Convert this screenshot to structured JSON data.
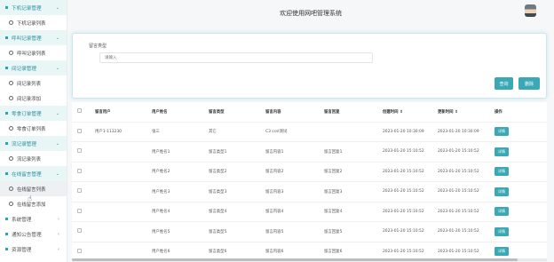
{
  "header": {
    "title": "欢迎使用网吧管理系统"
  },
  "sidebar": {
    "entries": [
      {
        "type": "group",
        "label": "下机记录管理",
        "chev": "⌄"
      },
      {
        "type": "item",
        "label": "下机记录列表"
      },
      {
        "type": "group",
        "label": "呼叫记录管理",
        "chev": "⌄"
      },
      {
        "type": "item",
        "label": "呼叫记录列表"
      },
      {
        "type": "group",
        "label": "间记录管理",
        "chev": "⌄"
      },
      {
        "type": "item",
        "label": "间记录列表"
      },
      {
        "type": "item",
        "label": "间记录添加"
      },
      {
        "type": "group",
        "label": "零食订单管理",
        "chev": "⌄"
      },
      {
        "type": "item",
        "label": "零食订单列表"
      },
      {
        "type": "group",
        "label": "流记录管理",
        "chev": "⌄"
      },
      {
        "type": "item",
        "label": "流记录列表"
      },
      {
        "type": "group",
        "label": "在线留言管理",
        "chev": "⌄"
      },
      {
        "type": "item",
        "label": "在线留言列表",
        "active": true
      },
      {
        "type": "item",
        "label": "在线留言添加"
      },
      {
        "type": "group-collapsed",
        "label": "系统管理",
        "chev": "‹"
      },
      {
        "type": "group-collapsed",
        "label": "通知公告管理",
        "chev": "‹"
      },
      {
        "type": "group-collapsed",
        "label": "资源管理",
        "chev": "‹"
      }
    ]
  },
  "search": {
    "label": "留言类型",
    "placeholder": "请输入",
    "query_label": "查询",
    "delete_label": "删除"
  },
  "table": {
    "headers": [
      "",
      "留言用户",
      "用户姓名",
      "留言类型",
      "留言内容",
      "留言回复",
      "创建时间 ⇕",
      "更新时间 ⇕",
      "操作"
    ],
    "rows": [
      [
        "",
        "用户1-113230",
        "张三",
        "其它",
        "C3 cssl测试",
        "",
        "2023-01-20 10:30:09",
        "2023-01-20 10:30:09",
        "详情"
      ],
      [
        "",
        "",
        "用户姓名1",
        "留言类型1",
        "留言内容1",
        "留言回复1",
        "2023-01-20 15:10:52",
        "2023-01-20 15:10:52",
        "详情"
      ],
      [
        "",
        "",
        "用户姓名2",
        "留言类型2",
        "留言内容2",
        "留言回复2",
        "2023-01-20 15:10:52",
        "2023-01-20 15:10:52",
        "详情"
      ],
      [
        "",
        "",
        "用户姓名3",
        "留言类型3",
        "留言内容3",
        "留言回复3",
        "2023-01-20 15:10:52",
        "2023-01-20 15:10:52",
        "详情"
      ],
      [
        "",
        "",
        "用户姓名4",
        "留言类型4",
        "留言内容4",
        "留言回复4",
        "2023-01-20 15:10:52",
        "2023-01-20 15:10:52",
        "详情"
      ],
      [
        "",
        "",
        "用户姓名5",
        "留言类型5",
        "留言内容5",
        "留言回复5",
        "2023-01-20 15:10:52",
        "2023-01-20 15:10:52",
        "详情"
      ],
      [
        "",
        "",
        "用户姓名6",
        "留言类型6",
        "留言内容6",
        "留言回复6",
        "2023-01-20 15:10:52",
        "2023-01-20 15:10:52",
        "详情"
      ]
    ]
  },
  "colors": {
    "accent": "#3ba8b6",
    "sidebar_group_bg": "#e9f6f6"
  }
}
